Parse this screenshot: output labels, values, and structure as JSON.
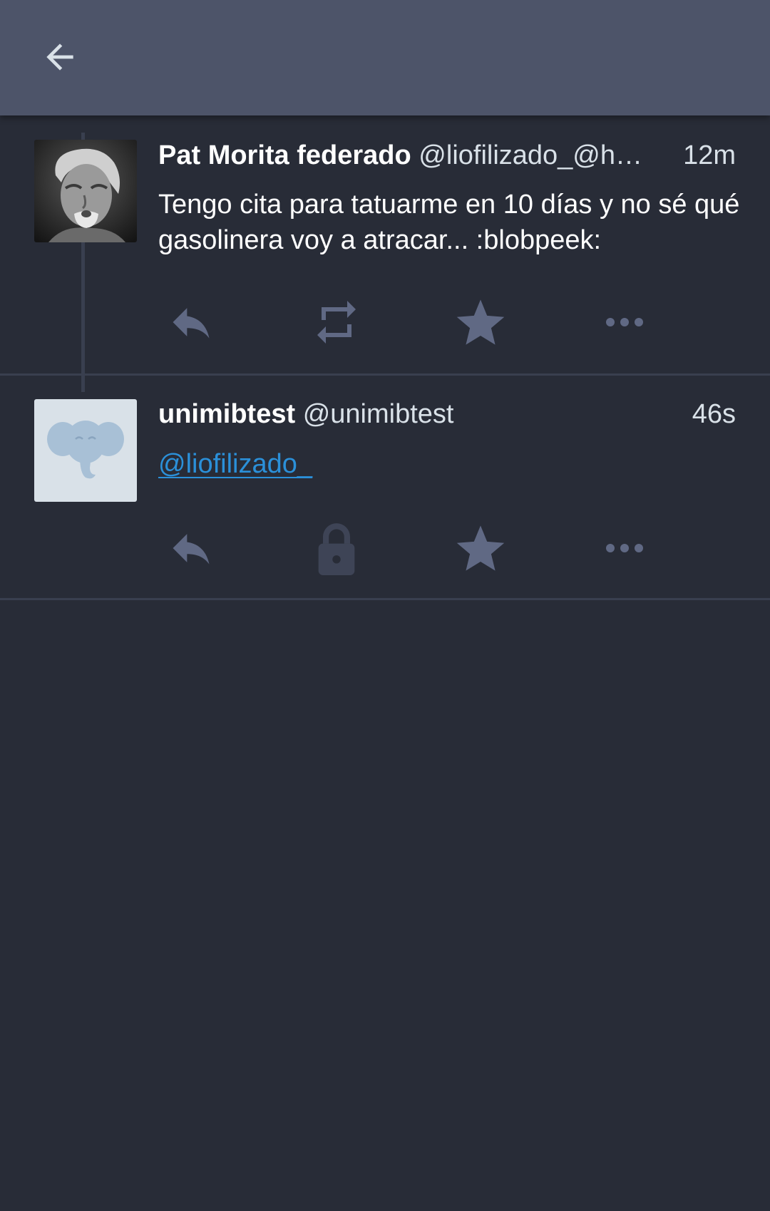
{
  "colors": {
    "background": "#282c37",
    "appbar": "#4d5469",
    "action_icon": "#606984",
    "action_icon_disabled": "#3e4456",
    "mention_link": "#2b90d9"
  },
  "appbar": {
    "back_icon": "arrow-left-icon"
  },
  "statuses": [
    {
      "display_name": "Pat Morita federado",
      "acct": "@liofilizado_@h…",
      "time": "12m",
      "content": "Tengo cita para tatuarme en 10 días y no sé qué gasolinera voy a atracar... :blobpeek:",
      "avatar": "user-photo-avatar",
      "actions": [
        "reply-icon",
        "boost-icon",
        "favourite-star-icon",
        "more-dots-icon"
      ]
    },
    {
      "display_name": "unimibtest",
      "acct": "@unimibtest",
      "time": "46s",
      "mention": "@liofilizado_",
      "avatar": "default-elephant-avatar",
      "actions": [
        "reply-icon",
        "lock-icon",
        "favourite-star-icon",
        "more-dots-icon"
      ]
    }
  ]
}
